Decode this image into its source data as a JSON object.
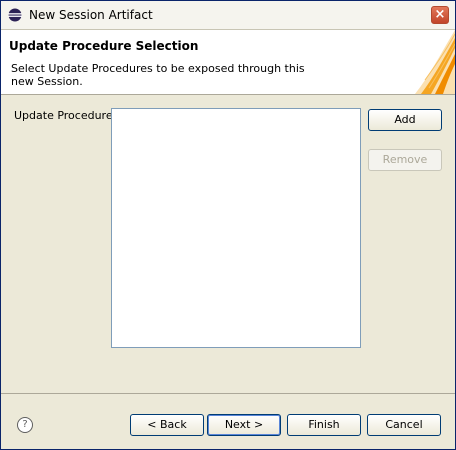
{
  "window": {
    "title": "New Session Artifact",
    "close_label": "×"
  },
  "banner": {
    "title": "Update Procedure Selection",
    "description": "Select Update Procedures to be exposed through this new Session."
  },
  "form": {
    "list_label": "Update Procedures",
    "list_items": [],
    "add_label": "Add",
    "remove_label": "Remove"
  },
  "footer": {
    "help_glyph": "?",
    "back_label": "< Back",
    "next_label": "Next >",
    "finish_label": "Finish",
    "cancel_label": "Cancel"
  },
  "colors": {
    "window_bg": "#ece9d8",
    "list_border": "#7f9db9",
    "button_border": "#003c74",
    "banner_flame": "#f5a623"
  },
  "icons": {
    "app": "eclipse-icon",
    "close": "close-icon",
    "help": "help-icon"
  }
}
